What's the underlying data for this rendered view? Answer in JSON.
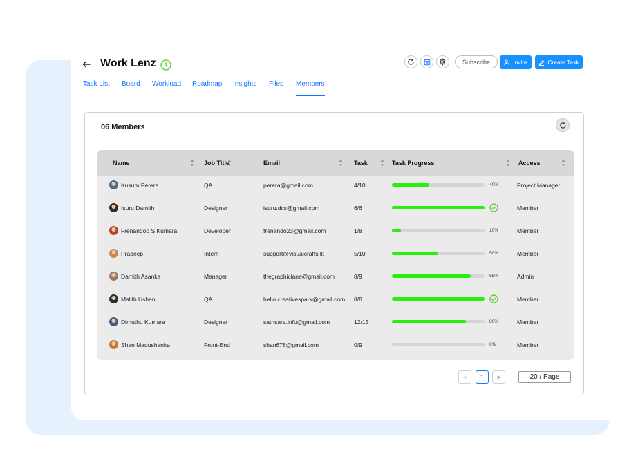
{
  "header": {
    "title": "Work Lenz",
    "subscribe_label": "Subscribe",
    "invite_label": "Invite",
    "create_task_label": "Create Task"
  },
  "tabs": [
    {
      "label": "Task List"
    },
    {
      "label": "Board"
    },
    {
      "label": "Workload"
    },
    {
      "label": "Roadmap"
    },
    {
      "label": "Insights"
    },
    {
      "label": "Files"
    },
    {
      "label": "Members"
    }
  ],
  "active_tab": "Members",
  "members_panel": {
    "title": "06 Members",
    "columns": [
      "Name",
      "Job Title",
      "Email",
      "Task",
      "Task Progress",
      "Access"
    ],
    "rows": [
      {
        "name": "Kusum Perera",
        "job": "QA",
        "email": "perera@gmail.com",
        "task": "4/10",
        "progress": 0.4,
        "progress_label": "40%",
        "access": "Project  Manager",
        "avatar_color": "#4a6a8a"
      },
      {
        "name": "Isuru Damith",
        "job": "Designer",
        "email": "isuru.dcs@gmail.com",
        "task": "6/6",
        "progress": 1.0,
        "progress_label": "",
        "access": "Member",
        "avatar_color": "#3b2a22"
      },
      {
        "name": "Frenandoo S Kumara",
        "job": "Developer",
        "email": "frenando23@gmail.com",
        "task": "1/8",
        "progress": 0.1,
        "progress_label": "10%",
        "access": "Member",
        "avatar_color": "#b8452b"
      },
      {
        "name": "Pradeep",
        "job": "Intern",
        "email": "support@visualcrafts.lk",
        "task": "5/10",
        "progress": 0.5,
        "progress_label": "50%",
        "access": "Member",
        "avatar_color": "#c98a4b"
      },
      {
        "name": "Damith Asanka",
        "job": "Manager",
        "email": "thegraphiclane@gmail.com",
        "task": "8/9",
        "progress": 0.85,
        "progress_label": "85%",
        "access": "Admin",
        "avatar_color": "#9a7b66"
      },
      {
        "name": "Malith Ushan",
        "job": "QA",
        "email": "hello.creativespark@gmail.com",
        "task": "8/8",
        "progress": 1.0,
        "progress_label": "",
        "access": "Member",
        "avatar_color": "#2b2b2b"
      },
      {
        "name": "Dimuthu Kumara",
        "job": "Designer",
        "email": "sathsara.info@gmail.com",
        "task": "12/15",
        "progress": 0.8,
        "progress_label": "80%",
        "access": "Member",
        "avatar_color": "#3e5f80"
      },
      {
        "name": "Shan Madushanka",
        "job": "Front-End",
        "email": "shan678@gmail.com",
        "task": "0/9",
        "progress": 0.0,
        "progress_label": "0%",
        "access": "Member",
        "avatar_color": "#c7782c"
      }
    ]
  },
  "pagination": {
    "current_page": "1",
    "prev": "<",
    "next": ">",
    "page_size": "20 / Page"
  },
  "colors": {
    "accent": "#1890ff",
    "progress": "#2aee0f",
    "complete_check": "#52c41a",
    "background_shape": "#e6f1fe"
  }
}
